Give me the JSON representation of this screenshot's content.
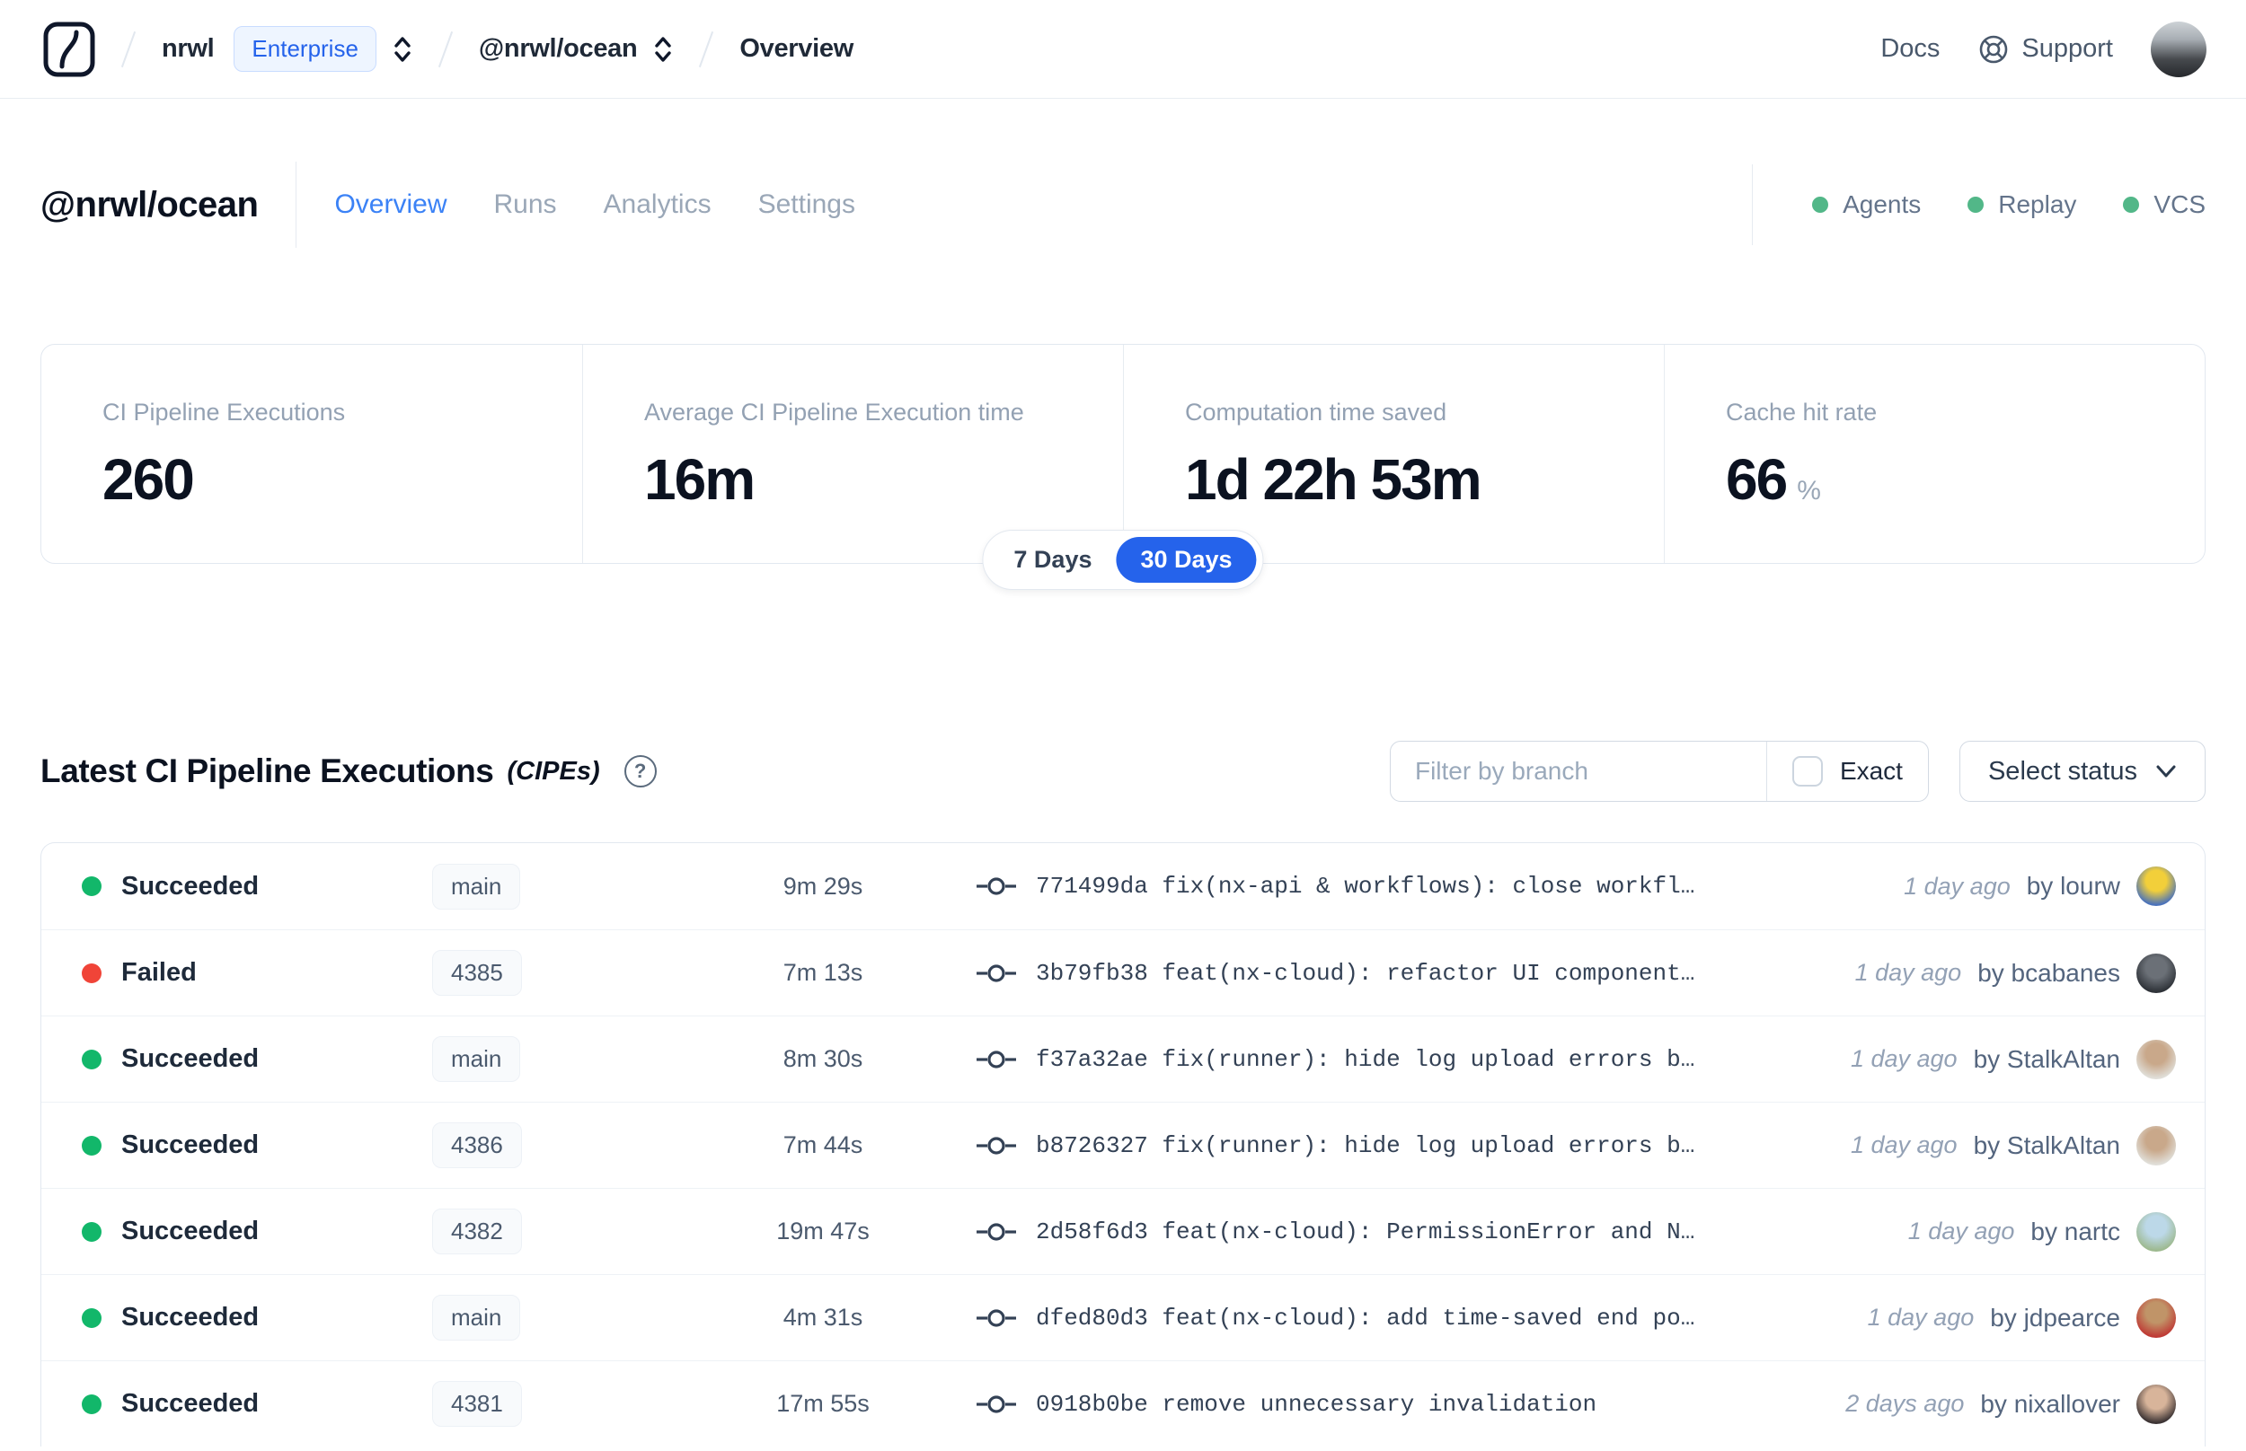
{
  "theme": {
    "accent_blue": "#2563eb",
    "tab_active_blue": "#3b82f6",
    "succeeded": "#12b76a",
    "failed": "#f04438",
    "integration_dot": "#52b788"
  },
  "navbar": {
    "org": "nrwl",
    "org_badge": "Enterprise",
    "workspace": "@nrwl/ocean",
    "page": "Overview",
    "docs": "Docs",
    "support": "Support"
  },
  "header": {
    "title": "@nrwl/ocean",
    "tabs": [
      {
        "label": "Overview",
        "active": true
      },
      {
        "label": "Runs",
        "active": false
      },
      {
        "label": "Analytics",
        "active": false
      },
      {
        "label": "Settings",
        "active": false
      }
    ],
    "integrations": [
      {
        "label": "Agents"
      },
      {
        "label": "Replay"
      },
      {
        "label": "VCS"
      }
    ]
  },
  "stats": {
    "selected_period": "30 Days",
    "periods": [
      "7 Days",
      "30 Days"
    ],
    "cards": [
      {
        "label": "CI Pipeline Executions",
        "value": "260",
        "unit": ""
      },
      {
        "label": "Average CI Pipeline Execution time",
        "value": "16m",
        "unit": ""
      },
      {
        "label": "Computation time saved",
        "value": "1d 22h 53m",
        "unit": ""
      },
      {
        "label": "Cache hit rate",
        "value": "66",
        "unit": "%"
      }
    ]
  },
  "cipe_section": {
    "title": "Latest CI Pipeline Executions",
    "subtitle": "(CIPEs)",
    "help_glyph": "?",
    "filter_placeholder": "Filter by branch",
    "exact_label": "Exact",
    "status_select_label": "Select status",
    "rows": [
      {
        "status": "succeeded",
        "status_label": "Succeeded",
        "branch": "main",
        "duration": "9m 29s",
        "commit": "771499da fix(nx-api & workflows): close workfl…",
        "time": "1 day ago",
        "author": "by lourw",
        "avatar": [
          "#f2cf3a",
          "#4a72bb"
        ]
      },
      {
        "status": "failed",
        "status_label": "Failed",
        "branch": "4385",
        "duration": "7m 13s",
        "commit": "3b79fb38 feat(nx-cloud): refactor UI component…",
        "time": "1 day ago",
        "author": "by bcabanes",
        "avatar": [
          "#6b7077",
          "#2e3238"
        ]
      },
      {
        "status": "succeeded",
        "status_label": "Succeeded",
        "branch": "main",
        "duration": "8m 30s",
        "commit": "f37a32ae fix(runner): hide log upload errors b…",
        "time": "1 day ago",
        "author": "by StalkAltan",
        "avatar": [
          "#c9a88a",
          "#e0ded8"
        ]
      },
      {
        "status": "succeeded",
        "status_label": "Succeeded",
        "branch": "4386",
        "duration": "7m 44s",
        "commit": "b8726327 fix(runner): hide log upload errors b…",
        "time": "1 day ago",
        "author": "by StalkAltan",
        "avatar": [
          "#c9a88a",
          "#e0ded8"
        ]
      },
      {
        "status": "succeeded",
        "status_label": "Succeeded",
        "branch": "4382",
        "duration": "19m 47s",
        "commit": "2d58f6d3 feat(nx-cloud): PermissionError and N…",
        "time": "1 day ago",
        "author": "by nartc",
        "avatar": [
          "#bcd8e8",
          "#9db98f"
        ]
      },
      {
        "status": "succeeded",
        "status_label": "Succeeded",
        "branch": "main",
        "duration": "4m 31s",
        "commit": "dfed80d3 feat(nx-cloud): add time-saved end po…",
        "time": "1 day ago",
        "author": "by jdpearce",
        "avatar": [
          "#c09468",
          "#bf3a35"
        ]
      },
      {
        "status": "succeeded",
        "status_label": "Succeeded",
        "branch": "4381",
        "duration": "17m 55s",
        "commit": "0918b0be remove unnecessary invalidation",
        "time": "2 days ago",
        "author": "by nixallover",
        "avatar": [
          "#d8b49a",
          "#3a3233"
        ]
      }
    ]
  }
}
